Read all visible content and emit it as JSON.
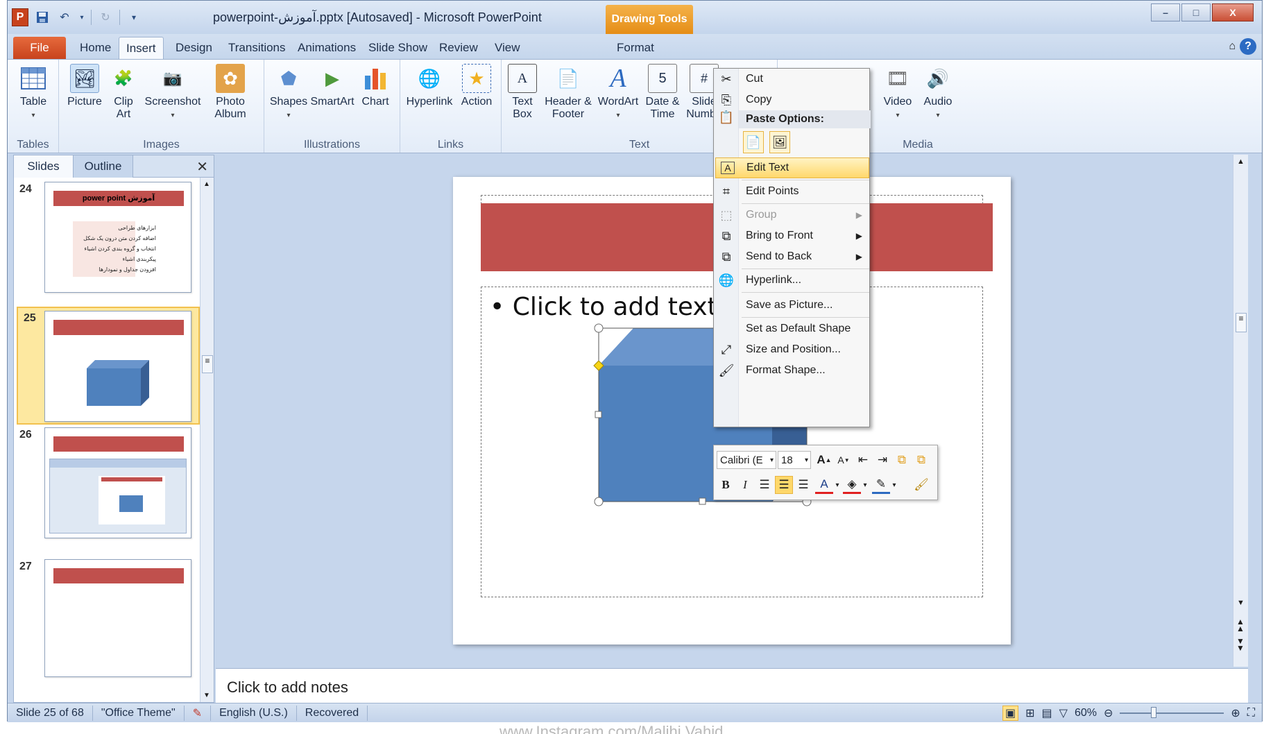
{
  "window": {
    "title": "powerpoint-آموزش.pptx [Autosaved]  -  Microsoft PowerPoint",
    "contextual_tab": "Drawing Tools",
    "controls": [
      "–",
      "□",
      "X"
    ]
  },
  "qat": {
    "app_icon": "P",
    "save_icon": "save-icon",
    "undo_icon": "undo-icon",
    "redo_icon": "redo-icon"
  },
  "tabs": [
    {
      "label": "File"
    },
    {
      "label": "Home"
    },
    {
      "label": "Insert"
    },
    {
      "label": "Design"
    },
    {
      "label": "Transitions"
    },
    {
      "label": "Animations"
    },
    {
      "label": "Slide Show"
    },
    {
      "label": "Review"
    },
    {
      "label": "View"
    },
    {
      "label": "Format"
    }
  ],
  "ribbon": {
    "groups": {
      "tables": "Tables",
      "images": "Images",
      "illustrations": "Illustrations",
      "links": "Links",
      "text": "Text",
      "media": "Media"
    },
    "buttons": {
      "table": "Table",
      "picture": "Picture",
      "clip_art": "Clip Art",
      "screenshot": "Screenshot",
      "photo_album": "Photo Album",
      "shapes": "Shapes",
      "smartart": "SmartArt",
      "chart": "Chart",
      "hyperlink": "Hyperlink",
      "action": "Action",
      "text_box": "Text Box",
      "header_footer": "Header & Footer",
      "wordart": "WordArt",
      "date_time": "Date & Time",
      "slide_number": "Slide Numbe",
      "video": "Video",
      "audio": "Audio"
    }
  },
  "slides_pane": {
    "tabs": [
      "Slides",
      "Outline"
    ],
    "close": "✕",
    "thumbs": [
      {
        "num": "24",
        "title": "آموزش power point",
        "lines": [
          "ابزارهای طراحی",
          "اضافه کردن متن درون یک شکل",
          "انتخاب و گروه بندی کردن اشیاء",
          "پیکربندی اشیاء",
          "افزودن جداول و نمودارها"
        ]
      },
      {
        "num": "25"
      },
      {
        "num": "26"
      },
      {
        "num": "27"
      }
    ]
  },
  "slide": {
    "content_text": "Click to add text"
  },
  "context_menu": {
    "items": [
      {
        "label": "Cut",
        "icon": "scissors-icon"
      },
      {
        "label": "Copy",
        "icon": "copy-icon"
      },
      {
        "label": "Paste Options:",
        "icon": "paste-icon"
      },
      {
        "label": "Edit Text",
        "icon": "edit-text-icon"
      },
      {
        "label": "Edit Points",
        "icon": "edit-points-icon"
      },
      {
        "label": "Group",
        "icon": "group-icon"
      },
      {
        "label": "Bring to Front",
        "icon": "bring-front-icon"
      },
      {
        "label": "Send to Back",
        "icon": "send-back-icon"
      },
      {
        "label": "Hyperlink...",
        "icon": "hyperlink-icon"
      },
      {
        "label": "Save as Picture...",
        "icon": ""
      },
      {
        "label": "Set as Default Shape",
        "icon": ""
      },
      {
        "label": "Size and Position...",
        "icon": "size-position-icon"
      },
      {
        "label": "Format Shape...",
        "icon": "format-shape-icon"
      }
    ]
  },
  "mini_toolbar": {
    "font": "Calibri (E",
    "size": "18"
  },
  "notes": {
    "placeholder": "Click to add notes"
  },
  "statusbar": {
    "slide": "Slide 25 of 68",
    "theme": "\"Office Theme\"",
    "language": "English (U.S.)",
    "recovered": "Recovered",
    "zoom": "60%"
  },
  "watermark": "www.Instagram.com/Malihi.Vahid",
  "colors": {
    "accent_red": "#c0504d",
    "shape_blue": "#4f81bd",
    "file_tab": "#c8431d",
    "highlight": "#ffd86b"
  }
}
